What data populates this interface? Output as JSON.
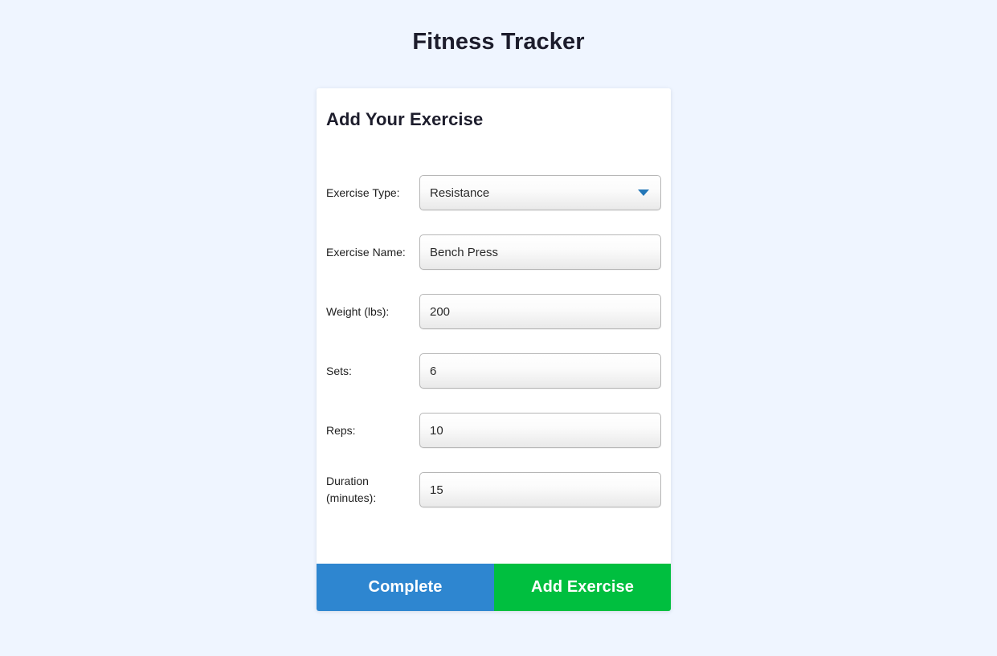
{
  "app": {
    "title": "Fitness Tracker",
    "background_color": "#eff5ff"
  },
  "card": {
    "heading": "Add Your Exercise",
    "fields": [
      {
        "label": "Exercise Type:",
        "type": "select",
        "value": "Resistance",
        "icon": "chevron-down-icon",
        "icon_color": "#2477b8"
      },
      {
        "label": "Exercise Name:",
        "type": "text",
        "value": "Bench Press"
      },
      {
        "label": "Weight (lbs):",
        "type": "text",
        "value": "200"
      },
      {
        "label": "Sets:",
        "type": "text",
        "value": "6"
      },
      {
        "label": "Reps:",
        "type": "text",
        "value": "10"
      },
      {
        "label": "Duration (minutes):",
        "type": "text",
        "value": "15"
      }
    ],
    "footer": {
      "complete_label": "Complete",
      "complete_color": "#2e86d0",
      "add_label": "Add Exercise",
      "add_color": "#00bf3f"
    }
  }
}
